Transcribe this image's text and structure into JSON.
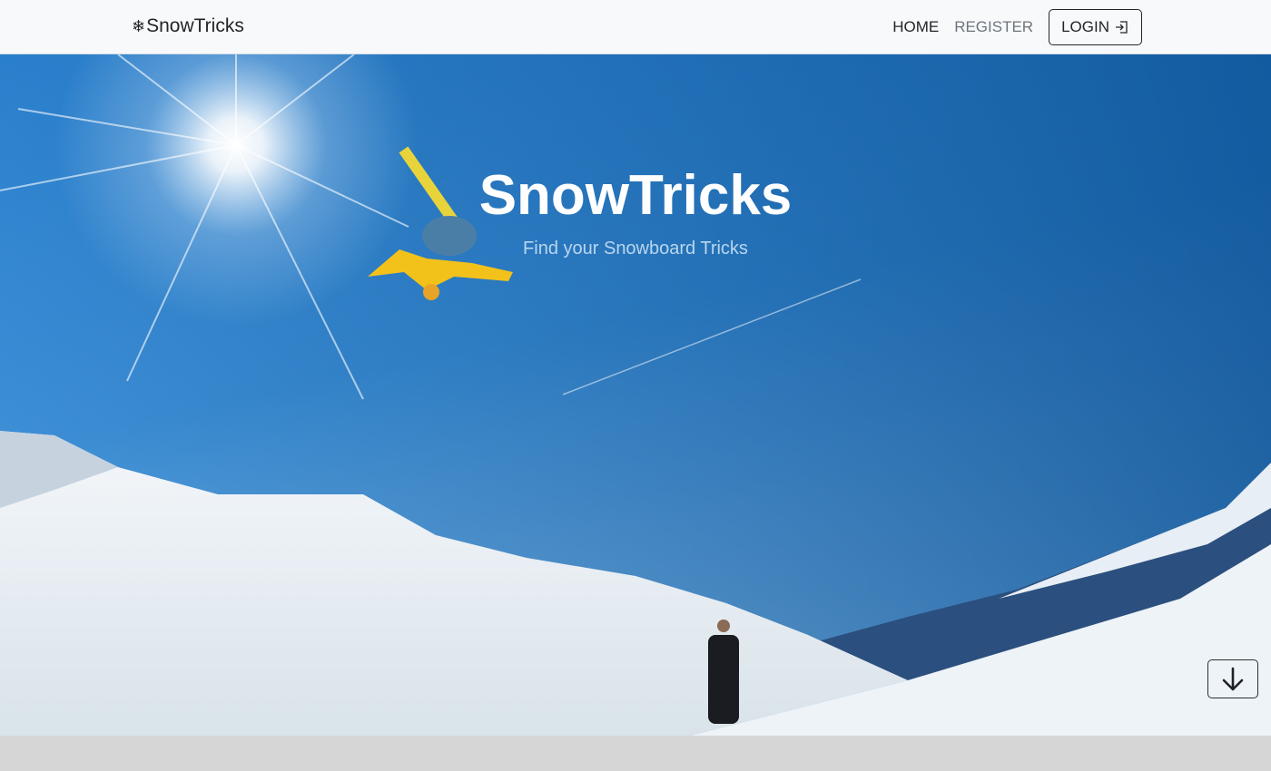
{
  "navbar": {
    "brand": "SnowTricks",
    "brand_icon": "snowflake-icon",
    "items": [
      {
        "label": "HOME"
      },
      {
        "label": "REGISTER"
      }
    ],
    "login_label": "LOGIN",
    "login_icon": "login-icon"
  },
  "hero": {
    "title": "SnowTricks",
    "subtitle": "Find your Snowboard Tricks",
    "scroll_icon": "arrow-down-icon"
  },
  "colors": {
    "navbar_bg": "#f8f9fa",
    "sky_top": "#0c5fa8",
    "sky_bottom": "#7ab6e4",
    "footer_bg": "#d6d6d6"
  }
}
